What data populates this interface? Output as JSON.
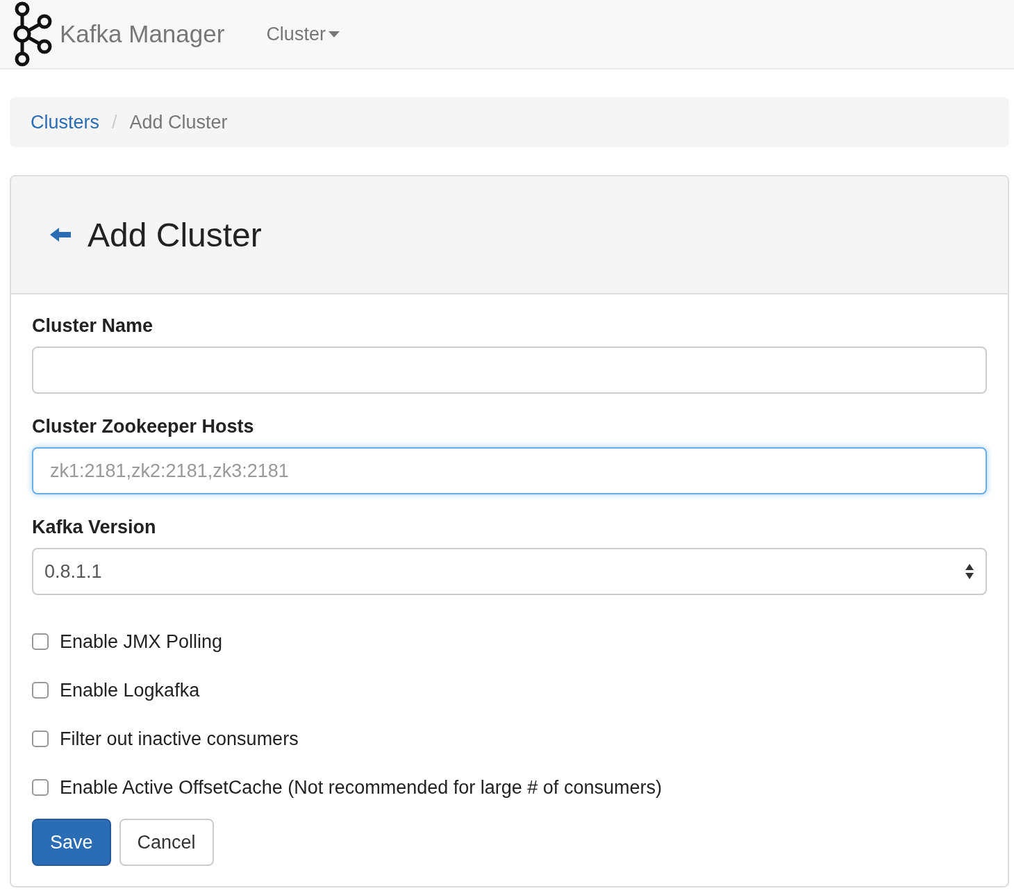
{
  "navbar": {
    "brand": "Kafka Manager",
    "menu": [
      {
        "label": "Cluster",
        "expanded": false
      }
    ]
  },
  "breadcrumb": {
    "separator": "/",
    "items": [
      {
        "label": "Clusters",
        "kind": "link"
      },
      {
        "label": "Add Cluster",
        "kind": "current"
      }
    ]
  },
  "panel": {
    "title": "Add Cluster",
    "fields": [
      {
        "kind": "text",
        "label": "Cluster Name",
        "focused": false
      },
      {
        "kind": "text",
        "label": "Cluster Zookeeper Hosts",
        "placeholder": "zk1:2181,zk2:2181,zk3:2181",
        "focused": true
      },
      {
        "kind": "select",
        "label": "Kafka Version",
        "value": "0.8.1.1",
        "focused": false
      }
    ],
    "checkboxes": [
      {
        "label": "Enable JMX Polling",
        "checked": false
      },
      {
        "label": "Enable Logkafka",
        "checked": false
      },
      {
        "label": "Filter out inactive consumers",
        "checked": false
      },
      {
        "label": "Enable Active OffsetCache (Not recommended for large # of consumers)",
        "checked": false
      }
    ],
    "buttons": [
      {
        "label": "Save",
        "kind": "primary"
      },
      {
        "label": "Cancel",
        "kind": "default"
      }
    ]
  }
}
